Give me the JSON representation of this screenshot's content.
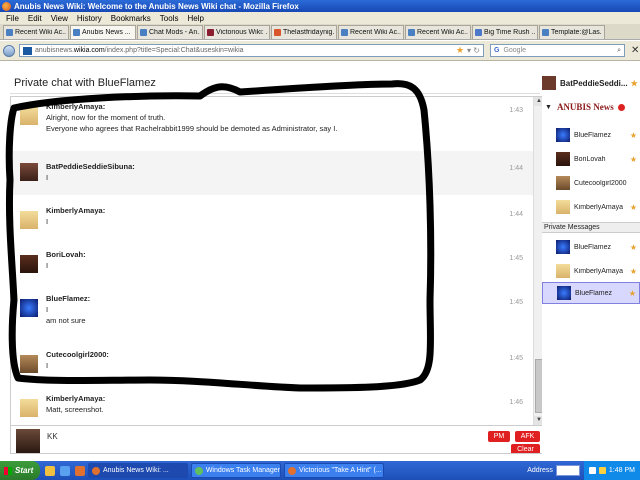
{
  "window": {
    "title": "Anubis News Wiki: Welcome to the Anubis News Wiki chat - Mozilla Firefox"
  },
  "menu": [
    "File",
    "Edit",
    "View",
    "History",
    "Bookmarks",
    "Tools",
    "Help"
  ],
  "tabs": [
    {
      "label": "Recent Wiki Ac...",
      "icon": "wiki-icon"
    },
    {
      "label": "Anubis News ...",
      "icon": "wiki-icon",
      "active": true
    },
    {
      "label": "Chat Mods - An...",
      "icon": "wiki-icon"
    },
    {
      "label": "Victorious Wiki: ...",
      "icon": "victorious-icon"
    },
    {
      "label": "Thelastfridaynig...",
      "icon": "wiki-icon"
    },
    {
      "label": "Recent Wiki Ac...",
      "icon": "wiki-icon"
    },
    {
      "label": "Recent Wiki Ac...",
      "icon": "wiki-icon"
    },
    {
      "label": "Big Time Rush ...",
      "icon": "wiki-icon"
    },
    {
      "label": "Template:@Las...",
      "icon": "wiki-icon"
    }
  ],
  "nav": {
    "url_prefix": "anubisnews.",
    "url_domain": "wikia.com",
    "url_suffix": "/index.php?title=Special:Chat&useskin=wikia",
    "search_placeholder": "Google",
    "search_engine": "G"
  },
  "chat": {
    "header": "Private chat with BlueFlamez",
    "header_user": "BatPeddieSeddi...",
    "messages": [
      {
        "user": "KimberlyAmaya:",
        "lines": [
          "Alright, now for the moment of truth.",
          "Everyone who agrees that Rachelrabbit1999 should be demoted as Administrator, say I."
        ],
        "time": "1:43",
        "avatar": "kim"
      },
      {
        "user": "BatPeddieSeddieSibuna:",
        "lines": [
          "I"
        ],
        "time": "1:44",
        "avatar": "bat"
      },
      {
        "user": "KimberlyAmaya:",
        "lines": [
          "I"
        ],
        "time": "1:44",
        "avatar": "kim"
      },
      {
        "user": "BoriLovah:",
        "lines": [
          "I"
        ],
        "time": "1:45",
        "avatar": "bori"
      },
      {
        "user": "BlueFlamez:",
        "lines": [
          "I",
          "am not sure"
        ],
        "time": "1:45",
        "avatar": "blue"
      },
      {
        "user": "Cutecoolgirl2000:",
        "lines": [
          "I"
        ],
        "time": "1:45",
        "avatar": "cute"
      },
      {
        "user": "KimberlyAmaya:",
        "lines": [
          "Matt, screenshot."
        ],
        "time": "1:46",
        "avatar": "kim"
      }
    ],
    "input_value": "KK",
    "pm_label": "PM",
    "afk_label": "AFK",
    "clear_label": "Clear"
  },
  "rail": {
    "logo": "ANUBIS News",
    "users": [
      {
        "name": "BlueFlamez",
        "avatar": "blue"
      },
      {
        "name": "BoriLovah",
        "avatar": "bori"
      },
      {
        "name": "Cutecoolgirl2000",
        "avatar": "cute"
      },
      {
        "name": "KimberlyAmaya",
        "avatar": "kim"
      }
    ],
    "pm_section": "Private Messages",
    "pm_users": [
      {
        "name": "BlueFlamez",
        "avatar": "blue"
      },
      {
        "name": "KimberlyAmaya",
        "avatar": "kim"
      },
      {
        "name": "BlueFlamez",
        "avatar": "blue",
        "selected": true
      }
    ]
  },
  "taskbar": {
    "start": "Start",
    "tasks": [
      {
        "label": "Anubis News Wiki: ...",
        "active": true
      },
      {
        "label": "Windows Task Manager"
      },
      {
        "label": "Victorious \"Take A Hint\" (..."
      }
    ],
    "address_label": "Address",
    "clock": "1:48 PM"
  }
}
